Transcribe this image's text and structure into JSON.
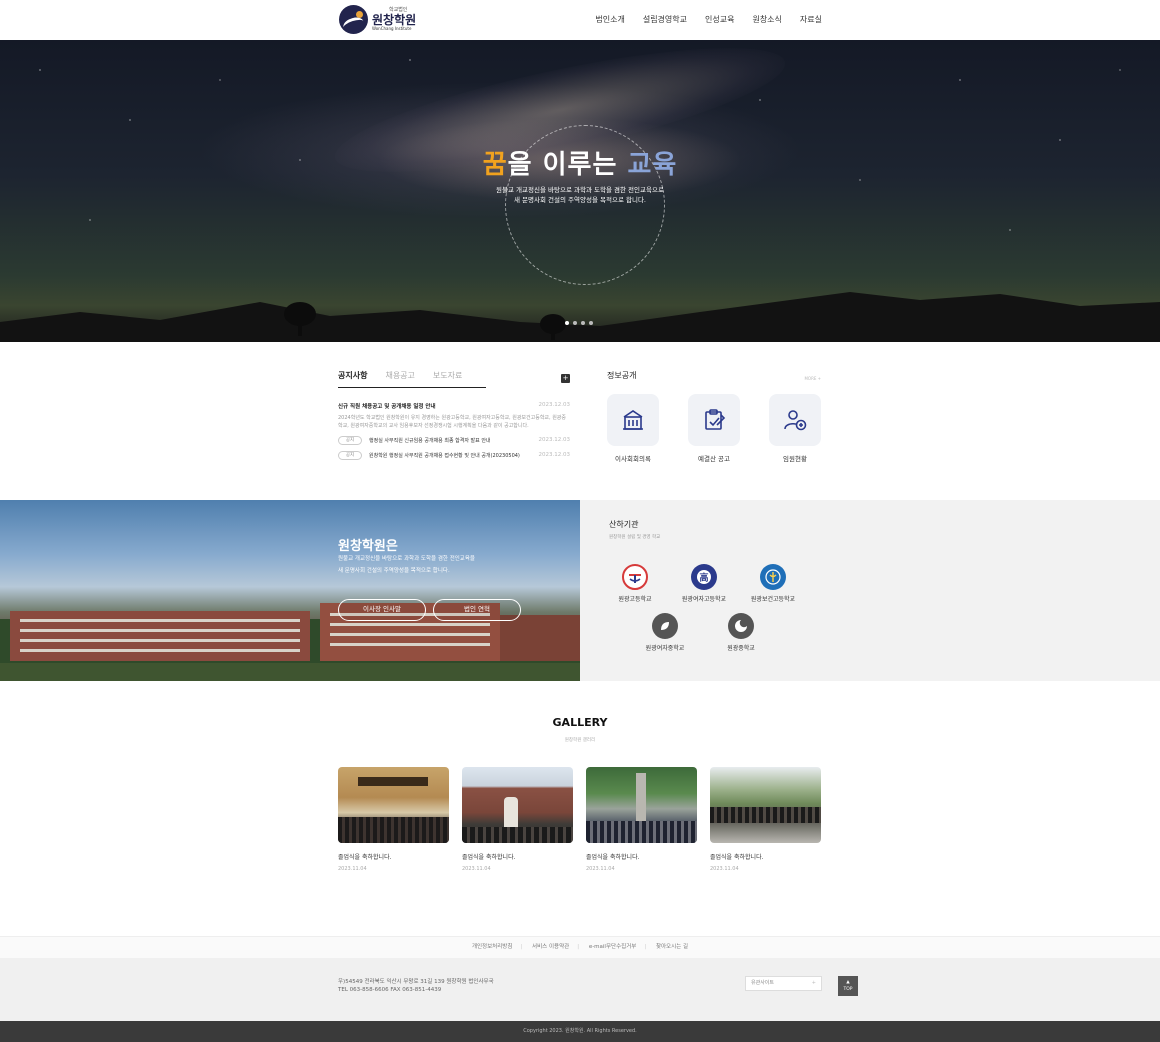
{
  "header": {
    "logo_sub": "학교법인",
    "logo_main": "원창학원",
    "logo_en": "WonChang Institute",
    "nav": [
      "법인소개",
      "설립경영학교",
      "인성교육",
      "원창소식",
      "자료실"
    ]
  },
  "hero": {
    "title_part1": "꿈",
    "title_part2": "을 이루는 ",
    "title_part3": "교육",
    "desc_line1": "원불교 개교정신을 바탕으로 과학과 도학을 겸한 전인교육으로",
    "desc_line2": "새 문명사회 건설의 주역양성을 목적으로 합니다."
  },
  "notice": {
    "tabs": [
      "공지사항",
      "채용공고",
      "보도자료"
    ],
    "plus": "+",
    "first": {
      "title": "신규 직원 채용공고 및 공개채용 일정 안내",
      "date": "2023.12.03",
      "summary": "2024학년도 학교법인 원창학원이 유지 경영하는 원광고등학교, 원광여자고등학교, 원광보건고등학교, 원광중학교, 원광여자중학교의 교사 임용후보자 선정경쟁시험 시행계획을 다음과 같이 공고합니다."
    },
    "rows": [
      {
        "badge": "공지",
        "title": "행정실 사무직원 신규임용 공개채용 최종 합격자 발표 안내",
        "date": "2023.12.03"
      },
      {
        "badge": "공지",
        "title": "원창학원 행정실 사무직원 공개채용 접수현황 및 안내 공개(20230504)",
        "date": "2023.12.03"
      }
    ]
  },
  "info": {
    "title": "정보공개",
    "more": "MORE +",
    "items": [
      {
        "label": "이사회회의록",
        "icon": "building-icon"
      },
      {
        "label": "예결산 공고",
        "icon": "clipboard-icon"
      },
      {
        "label": "임원현황",
        "icon": "user-add-icon"
      }
    ]
  },
  "about": {
    "title": "원창학원은",
    "desc_line1": "원불교 개교정신을 바탕으로 과학과 도학을 겸한 전인교육을",
    "desc_line2": "새 문명사회 건설의 주역양성을 목적으로 합니다.",
    "btn1": "이사장 인사말",
    "btn2": "법인 연혁"
  },
  "affil": {
    "title": "산하기관",
    "sub": "원창학원 설립 및 경영 학교",
    "schools": [
      "원광고등학교",
      "원광여자고등학교",
      "원광보건고등학교",
      "원광여자중학교",
      "원광중학교"
    ],
    "colors": {
      "wongwang_high": "#d63a3a",
      "girls_high": "#2b3a8c",
      "health_high": "#1f6fb8",
      "girls_middle": "#555555",
      "middle": "#555555"
    }
  },
  "gallery": {
    "title": "GALLERY",
    "sub": "원창학원 갤러리",
    "items": [
      {
        "caption": "졸업식을 축하합니다.",
        "date": "2023.11.04"
      },
      {
        "caption": "졸업식을 축하합니다.",
        "date": "2023.11.04"
      },
      {
        "caption": "졸업식을 축하합니다.",
        "date": "2023.11.04"
      },
      {
        "caption": "졸업식을 축하합니다.",
        "date": "2023.11.04"
      }
    ]
  },
  "footer": {
    "links": [
      "개인정보처리방침",
      "서비스 이용약관",
      "e-mail무단수집거부",
      "찾아오시는 길"
    ],
    "address": "우)54549 전라북도 익산시 무왕로 31길 139 원창학원 법인사무국",
    "tel": "TEL 063-858-6606 FAX 063-851-4439",
    "family_site": "유관사이트",
    "top_arrow": "▲",
    "top": "TOP",
    "copyright": "Copyright 2023. 원창학원. All Rights Reserved."
  }
}
